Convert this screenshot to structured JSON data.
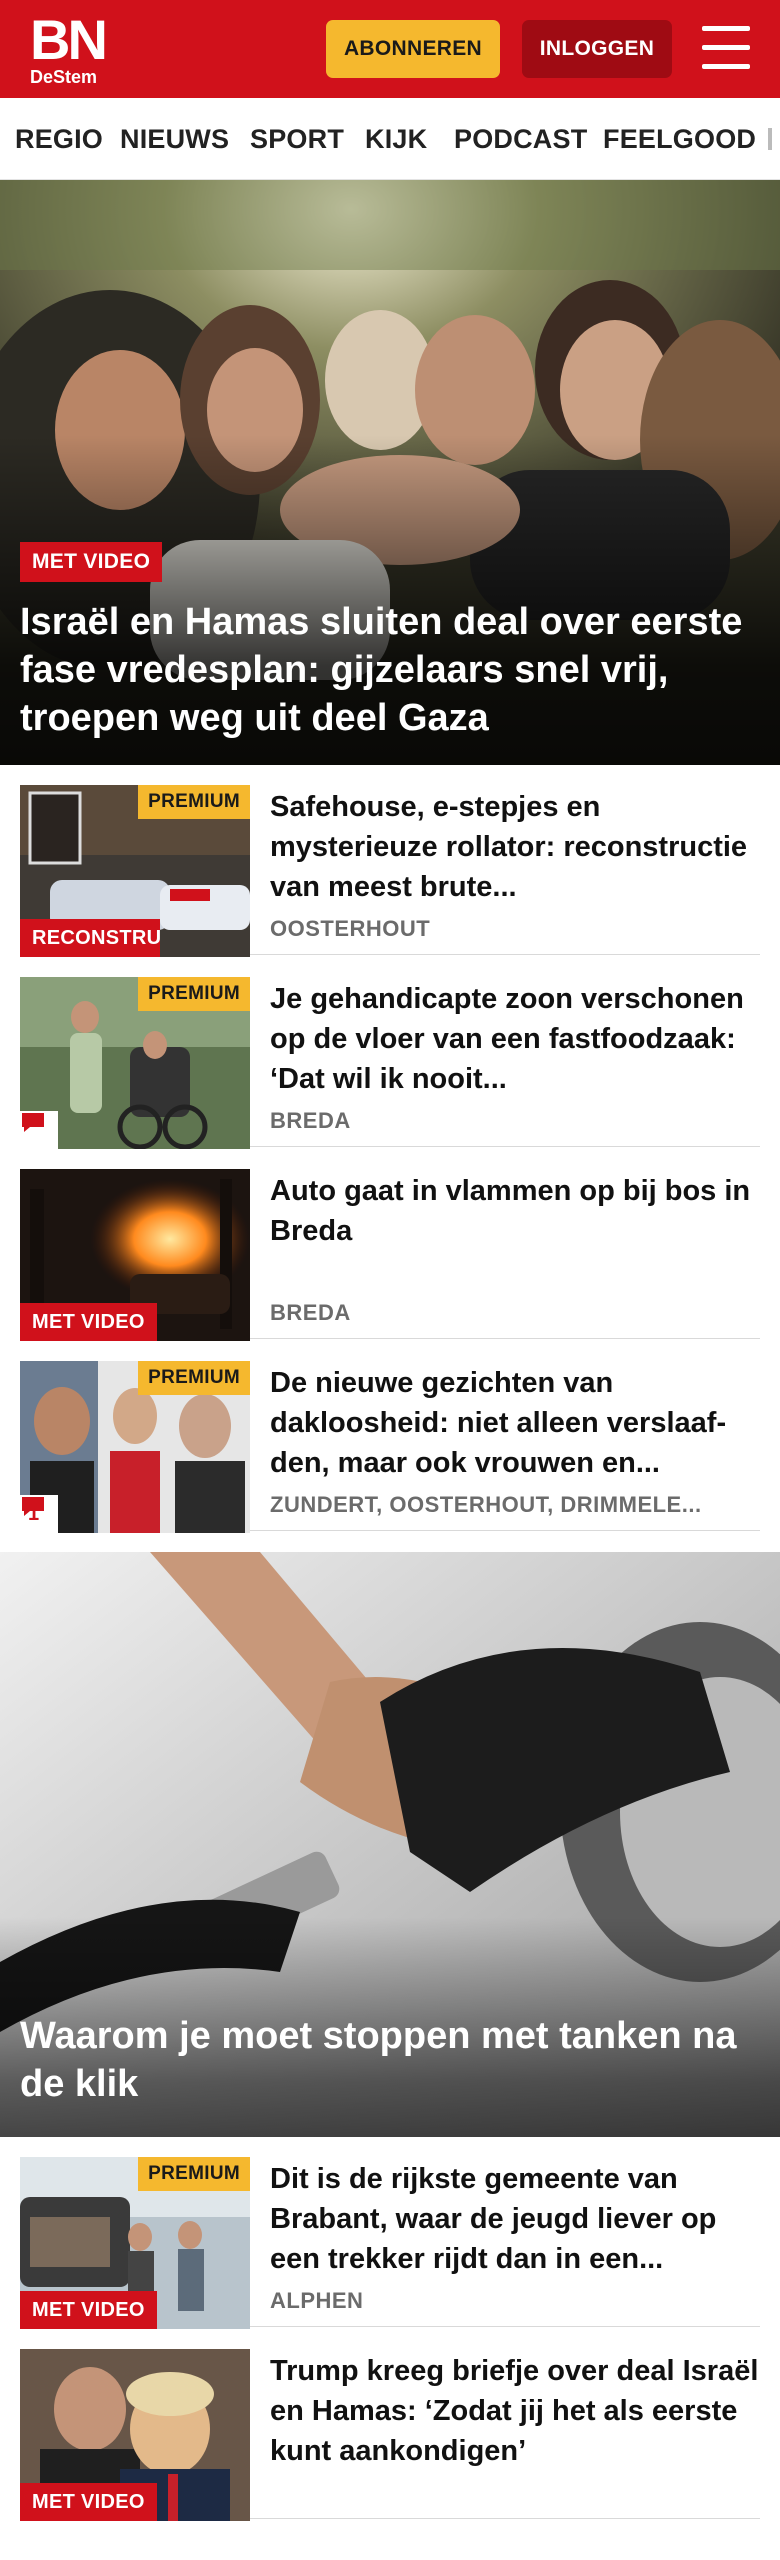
{
  "header": {
    "logo_main": "BN",
    "logo_sub": "DeStem",
    "subscribe_label": "ABONNEREN",
    "login_label": "INLOGGEN",
    "menu_icon": "hamburger-menu-icon",
    "brand_color": "#d0111b",
    "subscribe_color": "#f5b82e",
    "login_color": "#9f0b13"
  },
  "nav": {
    "items": [
      "REGIO",
      "NIEUWS",
      "SPORT",
      "KIJK",
      "PODCAST",
      "FEELGOOD"
    ]
  },
  "hero": {
    "badge": "MET VIDEO",
    "title": "Israël en Hamas sluiten deal over eerste fase vredesplan: gijzelaars snel vrij, troepen weg uit deel Gaza"
  },
  "articles": [
    {
      "premium": "PREMIUM",
      "badge": "RECONSTRUCTIE ...",
      "title": "Safehouse, e-stepjes en mysterieuze rollator: reconstructie van meest brute...",
      "location": "OOSTERHOUT"
    },
    {
      "premium": "PREMIUM",
      "comment_icon": "comment-icon",
      "title": "Je gehandicapte zoon verschonen op de vloer van een fastfoodzaak: ‘Dat wil ik nooit...",
      "location": "BREDA"
    },
    {
      "badge": "MET VIDEO",
      "title": "Auto gaat in vlammen op bij bos in Breda",
      "location": "BREDA"
    },
    {
      "premium": "PREMIUM",
      "comment_icon": "comment-icon",
      "comment_count": "1",
      "title": "De nieuwe gezichten van dakloosheid: niet alleen verslaaf-den, maar ook vrouwen en...",
      "location": "ZUNDERT, OOSTERHOUT, DRIMMELE..."
    }
  ],
  "feature": {
    "title": "Waarom je moet stoppen met tanken na de klik"
  },
  "articles2": [
    {
      "premium": "PREMIUM",
      "badge": "MET VIDEO",
      "title": "Dit is de rijkste gemeente van Brabant, waar de jeugd liever op een trekker rijdt dan in een...",
      "location": "ALPHEN"
    },
    {
      "badge": "MET VIDEO",
      "title": "Trump kreeg briefje over deal Israël en Hamas: ‘Zodat jij het als eerste kunt aankondigen’",
      "location": ""
    }
  ]
}
